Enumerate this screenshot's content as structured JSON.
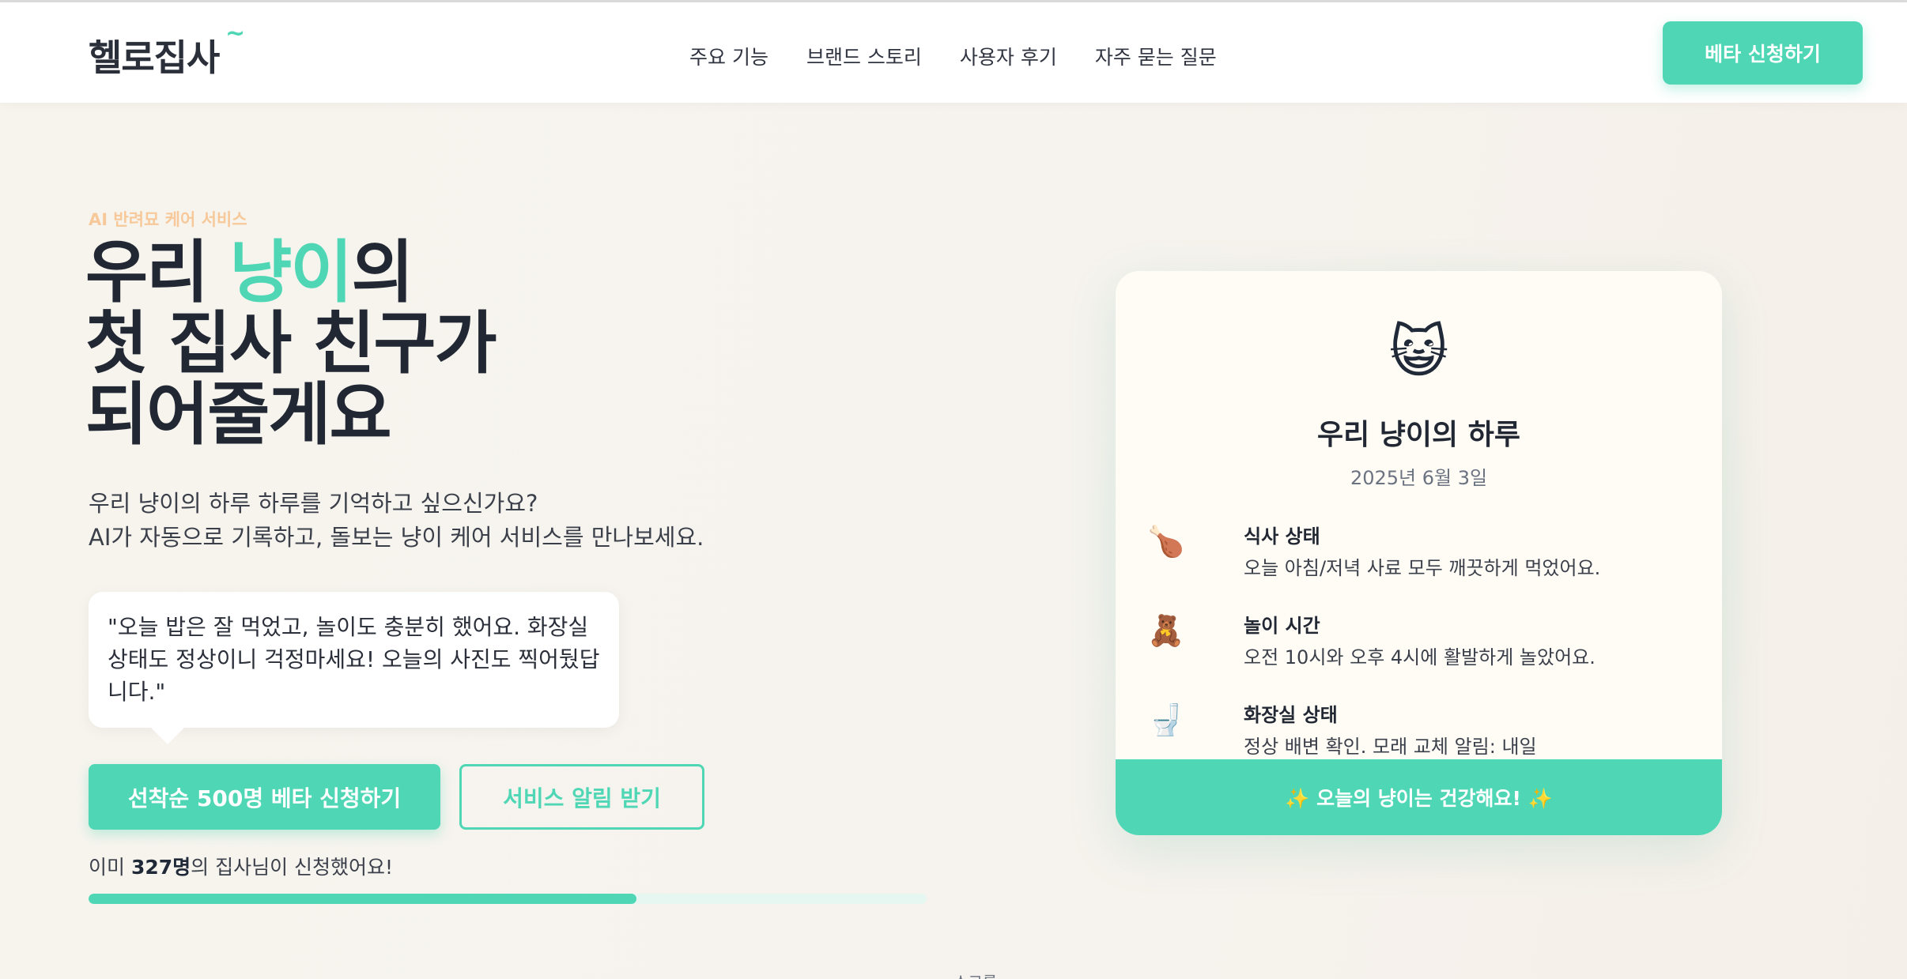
{
  "header": {
    "logo": "헬로집사",
    "logo_mark": "~",
    "nav": [
      "주요 기능",
      "브랜드 스토리",
      "사용자 후기",
      "자주 묻는 질문"
    ],
    "cta": "베타 신청하기"
  },
  "hero": {
    "eyebrow": "AI 반려묘 케어 서비스",
    "title_line1_pre": "우리 ",
    "title_line1_accent": "냥이",
    "title_line1_post": "의",
    "title_line2": "첫 집사 친구가",
    "title_line3": "되어줄게요",
    "subtitle_line1": "우리 냥이의 하루 하루를 기억하고 싶으신가요?",
    "subtitle_line2": "AI가 자동으로 기록하고, 돌보는 냥이 케어 서비스를 만나보세요.",
    "quote": "\"오늘 밥은 잘 먹었고, 놀이도 충분히 했어요. 화장실 상태도 정상이니 걱정마세요! 오늘의 사진도 찍어뒀답니다.\"",
    "primary_button": "선착순 500명 베타 신청하기",
    "secondary_button": "서비스 알림 받기",
    "applied_pre": "이미 ",
    "applied_count": "327명",
    "applied_post": "의 집사님이 신청했어요!",
    "progress": 0.654,
    "scroll_hint": "스크롤"
  },
  "card": {
    "emoji": "😺",
    "title": "우리 냥이의 하루",
    "date": "2025년 6월 3일",
    "items": [
      {
        "icon": "🍗",
        "icon_name": "food-icon",
        "title": "식사 상태",
        "desc": "오늘 아침/저녁 사료 모두 깨끗하게 먹었어요."
      },
      {
        "icon": "🧸",
        "icon_name": "toy-icon",
        "title": "놀이 시간",
        "desc": "오전 10시와 오후 4시에 활발하게 놀았어요."
      },
      {
        "icon": "🚽",
        "icon_name": "toilet-icon",
        "title": "화장실 상태",
        "desc": "정상 배변 확인. 모래 교체 알림: 내일"
      }
    ],
    "footer": "✨ 오늘의 냥이는 건강해요! ✨"
  },
  "colors": {
    "accent": "#4fd7b5",
    "eyebrow": "#f7c99a",
    "text_dark": "#222833"
  }
}
